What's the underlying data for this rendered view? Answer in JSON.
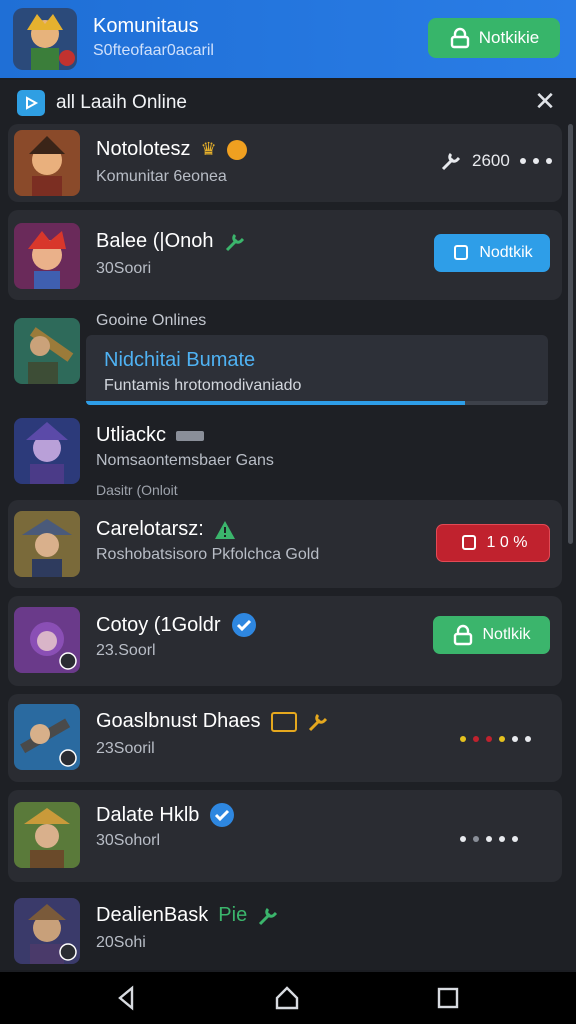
{
  "header": {
    "title": "Komunitaus",
    "subtitle": "S0fteofaar0acaril",
    "button_label": "Notkikie",
    "icon": "lock-icon"
  },
  "panel": {
    "title": "all Laaih Online",
    "close_icon": "close-icon"
  },
  "rows": [
    {
      "name": "Notolotesz",
      "sub": "Komunitar 6eonea",
      "action_value": "2600",
      "badges": [
        "crown-icon",
        "orange-dot"
      ]
    },
    {
      "name": "Balee (|Onoh",
      "sub": "30Soori",
      "button_label": "Nodtkik",
      "badges": [
        "wrench-icon"
      ]
    },
    {
      "section_label": "Gooine Onlines",
      "status_title": "Nidchitai Bumate",
      "status_text": "Funtamis hrotomodivaniado",
      "progress": 0.82
    },
    {
      "name": "Utliackc",
      "sub": "Nomsaontemsbaer Gans",
      "note": "Dasitr (Onloit"
    },
    {
      "name": "Carelotarsz:",
      "sub": "Roshobatsisoro Pkfolchca Gold",
      "button_label": "1 0 %",
      "badges": [
        "warning-icon"
      ]
    },
    {
      "name": "Cotoy (1Goldr",
      "sub": "23.Soorl",
      "button_label": "Notlkik",
      "badges": [
        "verified-icon"
      ]
    },
    {
      "name": "Goaslbnust Dhaes",
      "sub": "23Sooril",
      "badges": [
        "gold-badge",
        "wrench-icon"
      ]
    },
    {
      "name": "Dalate Hklb",
      "sub": "30Sohorl",
      "badges": [
        "verified-icon"
      ]
    },
    {
      "name": "DealienBask",
      "name_suffix": "Pie",
      "sub": "20Sohi",
      "badges": [
        "wrench-icon"
      ]
    }
  ],
  "colors": {
    "header": "#2a7de6",
    "accent_blue": "#2e9ee8",
    "accent_green": "#3bb56c",
    "accent_red": "#c0222e",
    "background": "#1e2025"
  },
  "navbar": {
    "icons": [
      "back-icon",
      "home-icon",
      "recents-icon"
    ]
  }
}
